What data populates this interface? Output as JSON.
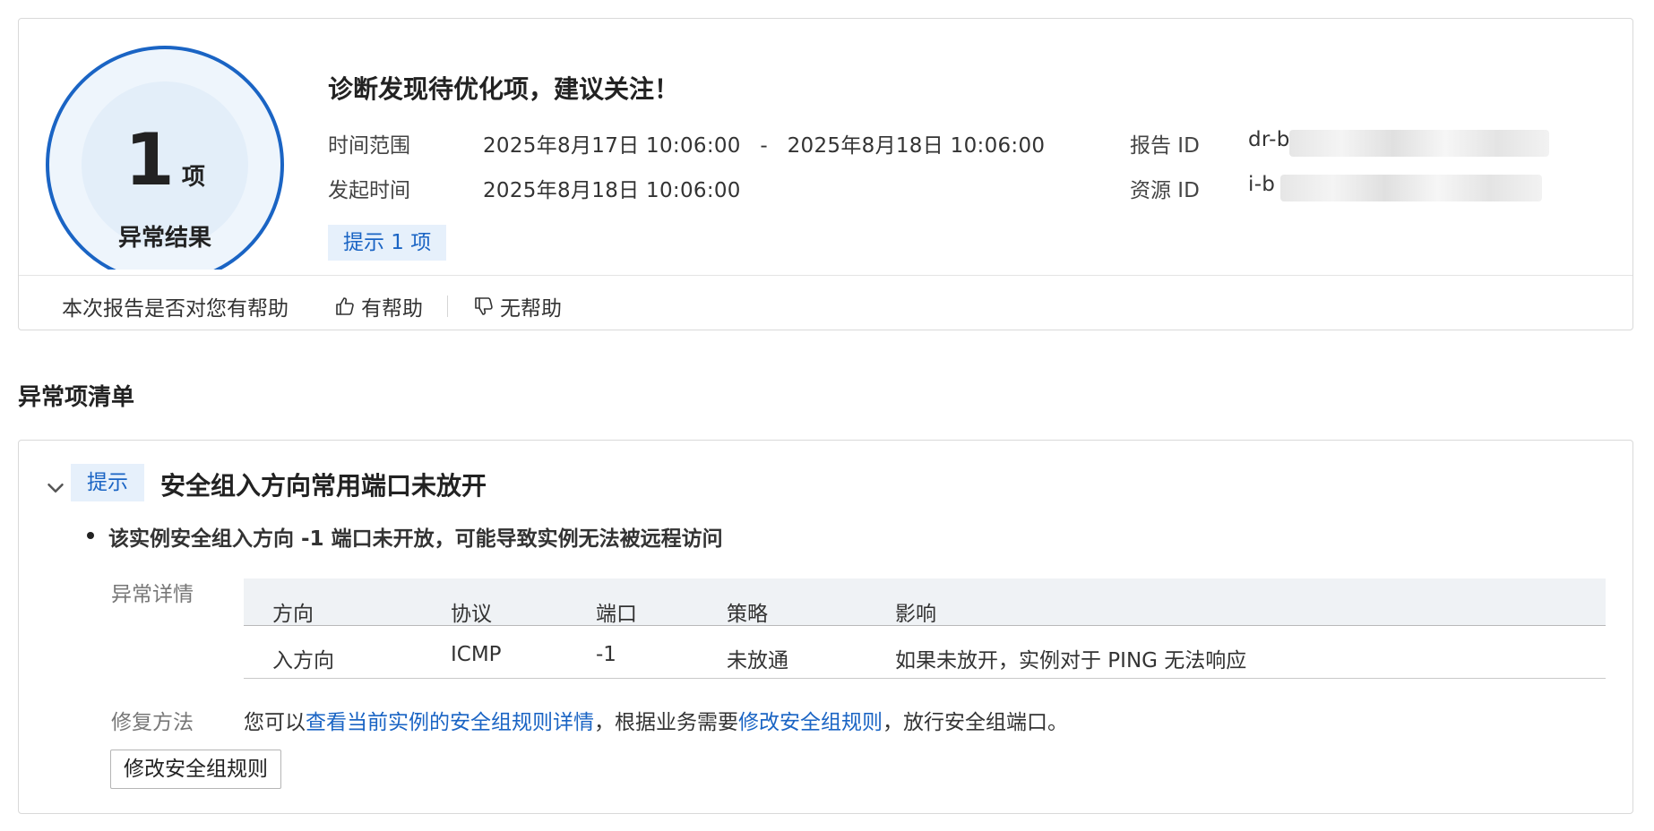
{
  "summary": {
    "count": "1",
    "count_unit": "项",
    "count_label": "异常结果",
    "title": "诊断发现待优化项，建议关注！",
    "time_range_label": "时间范围",
    "time_range_start": "2025年8月17日 10:06:00",
    "time_range_sep": "-",
    "time_range_end": "2025年8月18日 10:06:00",
    "start_time_label": "发起时间",
    "start_time_value": "2025年8月18日 10:06:00",
    "report_id_label": "报告 ID",
    "report_id_value": "dr-b",
    "resource_id_label": "资源 ID",
    "resource_id_value": "i-b",
    "tip_badge": "提示 1 项"
  },
  "feedback": {
    "question": "本次报告是否对您有帮助",
    "helpful_label": "有帮助",
    "unhelpful_label": "无帮助"
  },
  "section": {
    "title": "异常项清单"
  },
  "issue": {
    "level_badge": "提示",
    "title": "安全组入方向常用端口未放开",
    "description": "该实例安全组入方向 -1 端口未开放，可能导致实例无法被远程访问",
    "detail_label": "异常详情",
    "table": {
      "columns": [
        "方向",
        "协议",
        "端口",
        "策略",
        "影响"
      ],
      "rows": [
        [
          "入方向",
          "ICMP",
          "-1",
          "未放通",
          "如果未放开，实例对于 PING 无法响应"
        ]
      ]
    },
    "fix_label": "修复方法",
    "fix_text_1": "您可以",
    "fix_link_1": "查看当前实例的安全组规则详情",
    "fix_text_2": "，根据业务需要",
    "fix_link_2": "修改安全组规则",
    "fix_text_3": "，放行安全组端口。",
    "action_button": "修改安全组规则"
  },
  "colors": {
    "accent": "#1a64c4",
    "badge_bg": "#e6f0fb",
    "table_header_bg": "#eff2f5"
  },
  "icons": [
    "thumbs-up-icon",
    "thumbs-down-icon",
    "chevron-down-icon"
  ]
}
